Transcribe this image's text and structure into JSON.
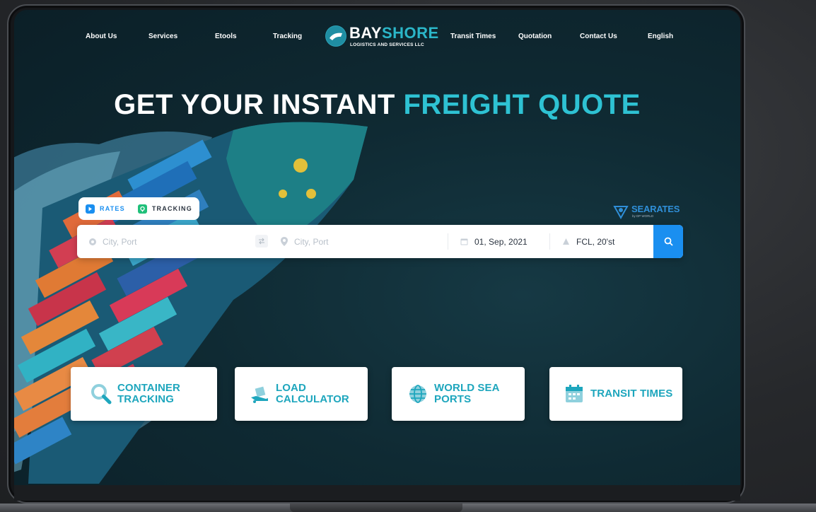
{
  "nav": {
    "about": "About Us",
    "services": "Services",
    "etools": "Etools",
    "tracking": "Tracking",
    "transit_times": "Transit Times",
    "quotation": "Quotation",
    "contact": "Contact Us",
    "language": "English"
  },
  "logo": {
    "title_main": "BAY",
    "title_accent": "SHORE",
    "subtitle": "LOGISTICS AND SERVICES LLC"
  },
  "hero": {
    "title_main": "GET YOUR INSTANT ",
    "title_accent": "FREIGHT QUOTE"
  },
  "tabs": [
    {
      "label": "RATES",
      "icon": "play-icon",
      "color": "#1a8ff0"
    },
    {
      "label": "TRACKING",
      "icon": "shield-check-icon",
      "color": "#20c07a"
    }
  ],
  "partner": {
    "name": "SEARATES",
    "tagline": "by DP WORLD"
  },
  "search": {
    "origin_placeholder": "City, Port",
    "destination_placeholder": "City, Port",
    "date": "01, Sep, 2021",
    "container": "FCL, 20'st"
  },
  "cards": [
    {
      "label": "CONTAINER\nTRACKING",
      "icon": "magnifier-icon"
    },
    {
      "label": "LOAD\nCALCULATOR",
      "icon": "truck-load-icon"
    },
    {
      "label": "WORLD SEA\nPORTS",
      "icon": "globe-icon"
    },
    {
      "label": "TRANSIT TIMES",
      "icon": "calendar-icon"
    }
  ],
  "colors": {
    "accent": "#2ec2d3",
    "button": "#1a8ff0",
    "card_text": "#1ea6bd"
  }
}
